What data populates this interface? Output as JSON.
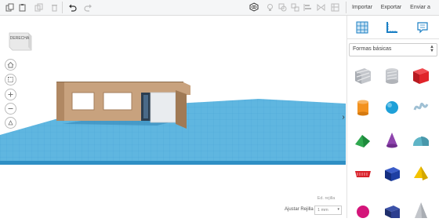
{
  "header": {
    "buttons": {
      "importar": "Importar",
      "exportar": "Exportar",
      "enviar": "Enviar a"
    }
  },
  "viewcube": {
    "label": "DERECHA"
  },
  "library": {
    "category": "Formas básicas",
    "shapes": [
      {
        "name": "box-hole",
        "color": "#b9bcc2"
      },
      {
        "name": "cylinder-hole",
        "color": "#c3c6cb"
      },
      {
        "name": "box",
        "color": "#e0242a"
      },
      {
        "name": "cylinder",
        "color": "#f3921f"
      },
      {
        "name": "sphere",
        "color": "#1ea0d8"
      },
      {
        "name": "scribble",
        "color": "#9fc0d4"
      },
      {
        "name": "roof",
        "color": "#2fa84f"
      },
      {
        "name": "cone",
        "color": "#8e44ad"
      },
      {
        "name": "round-roof",
        "color": "#5fb5c7"
      },
      {
        "name": "text",
        "color": "#d8222b"
      },
      {
        "name": "cube-blue",
        "color": "#1e3fa3"
      },
      {
        "name": "pyramid",
        "color": "#f4c300"
      },
      {
        "name": "sphere-magenta",
        "color": "#d4157a"
      },
      {
        "name": "box-navy",
        "color": "#2c3e8f"
      },
      {
        "name": "cone-gray",
        "color": "#b9bcc2"
      }
    ]
  },
  "footer": {
    "edit_grid": "Ed. rejilla",
    "snap_label": "Ajustar Rejilla",
    "snap_value": "1 mm"
  },
  "colors": {
    "grid": "#5fb6e0",
    "wall": "#c8a27e",
    "accent": "#e0242a"
  }
}
